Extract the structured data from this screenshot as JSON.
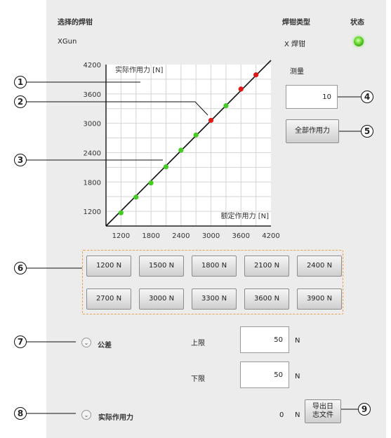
{
  "header": {
    "gun_label": "选择的焊钳",
    "gun_value": "XGun",
    "type_label": "焊钳类型",
    "type_value": "X 焊钳",
    "status_label": "状态",
    "status_color": "#5fd42a"
  },
  "chart_data": {
    "type": "scatter",
    "ylabel": "实际作用力 [N]",
    "xlabel": "额定作用力 [N]",
    "xlim": [
      900,
      4200
    ],
    "ylim": [
      900,
      4200
    ],
    "x_ticks": [
      1200,
      1800,
      2400,
      3000,
      3600,
      4200
    ],
    "y_ticks": [
      1200,
      1800,
      2400,
      3000,
      3600,
      4200
    ],
    "x_tick_labels": [
      "1200",
      "1800",
      "2400",
      "3000",
      "3600",
      "4200"
    ],
    "y_tick_labels": [
      "1200",
      "1800",
      "2400",
      "3000",
      "3600",
      "4200"
    ],
    "grid": true,
    "reference_line": {
      "x": [
        900,
        4200
      ],
      "y": [
        900,
        4200
      ]
    },
    "points": [
      {
        "x": 1200,
        "y": 1170,
        "color": "#44cc22"
      },
      {
        "x": 1500,
        "y": 1490,
        "color": "#44cc22"
      },
      {
        "x": 1800,
        "y": 1780,
        "color": "#44cc22"
      },
      {
        "x": 2100,
        "y": 2110,
        "color": "#44cc22"
      },
      {
        "x": 2400,
        "y": 2450,
        "color": "#44cc22"
      },
      {
        "x": 2700,
        "y": 2760,
        "color": "#44cc22"
      },
      {
        "x": 3000,
        "y": 3060,
        "color": "#e01818"
      },
      {
        "x": 3300,
        "y": 3360,
        "color": "#44cc22"
      },
      {
        "x": 3600,
        "y": 3700,
        "color": "#e01818"
      },
      {
        "x": 3900,
        "y": 3990,
        "color": "#e01818"
      }
    ]
  },
  "measure": {
    "label": "测量",
    "value": "10",
    "all_force_label": "全部作用力"
  },
  "force_buttons": [
    "1200 N",
    "1500 N",
    "1800 N",
    "2100 N",
    "2400 N",
    "2700 N",
    "3000 N",
    "3300 N",
    "3600 N",
    "3900 N"
  ],
  "tolerance": {
    "label": "公差",
    "upper_label": "上限",
    "upper_value": "50",
    "lower_label": "下限",
    "lower_value": "50",
    "unit": "N"
  },
  "actual_force": {
    "label": "实际作用力",
    "value": "0",
    "unit": "N",
    "export_label_1": "导出日",
    "export_label_2": "志文件"
  },
  "callouts": [
    "1",
    "2",
    "3",
    "4",
    "5",
    "6",
    "7",
    "8",
    "9"
  ],
  "icons": {
    "expand": "chevron-down-icon",
    "status": "led-indicator-icon"
  }
}
